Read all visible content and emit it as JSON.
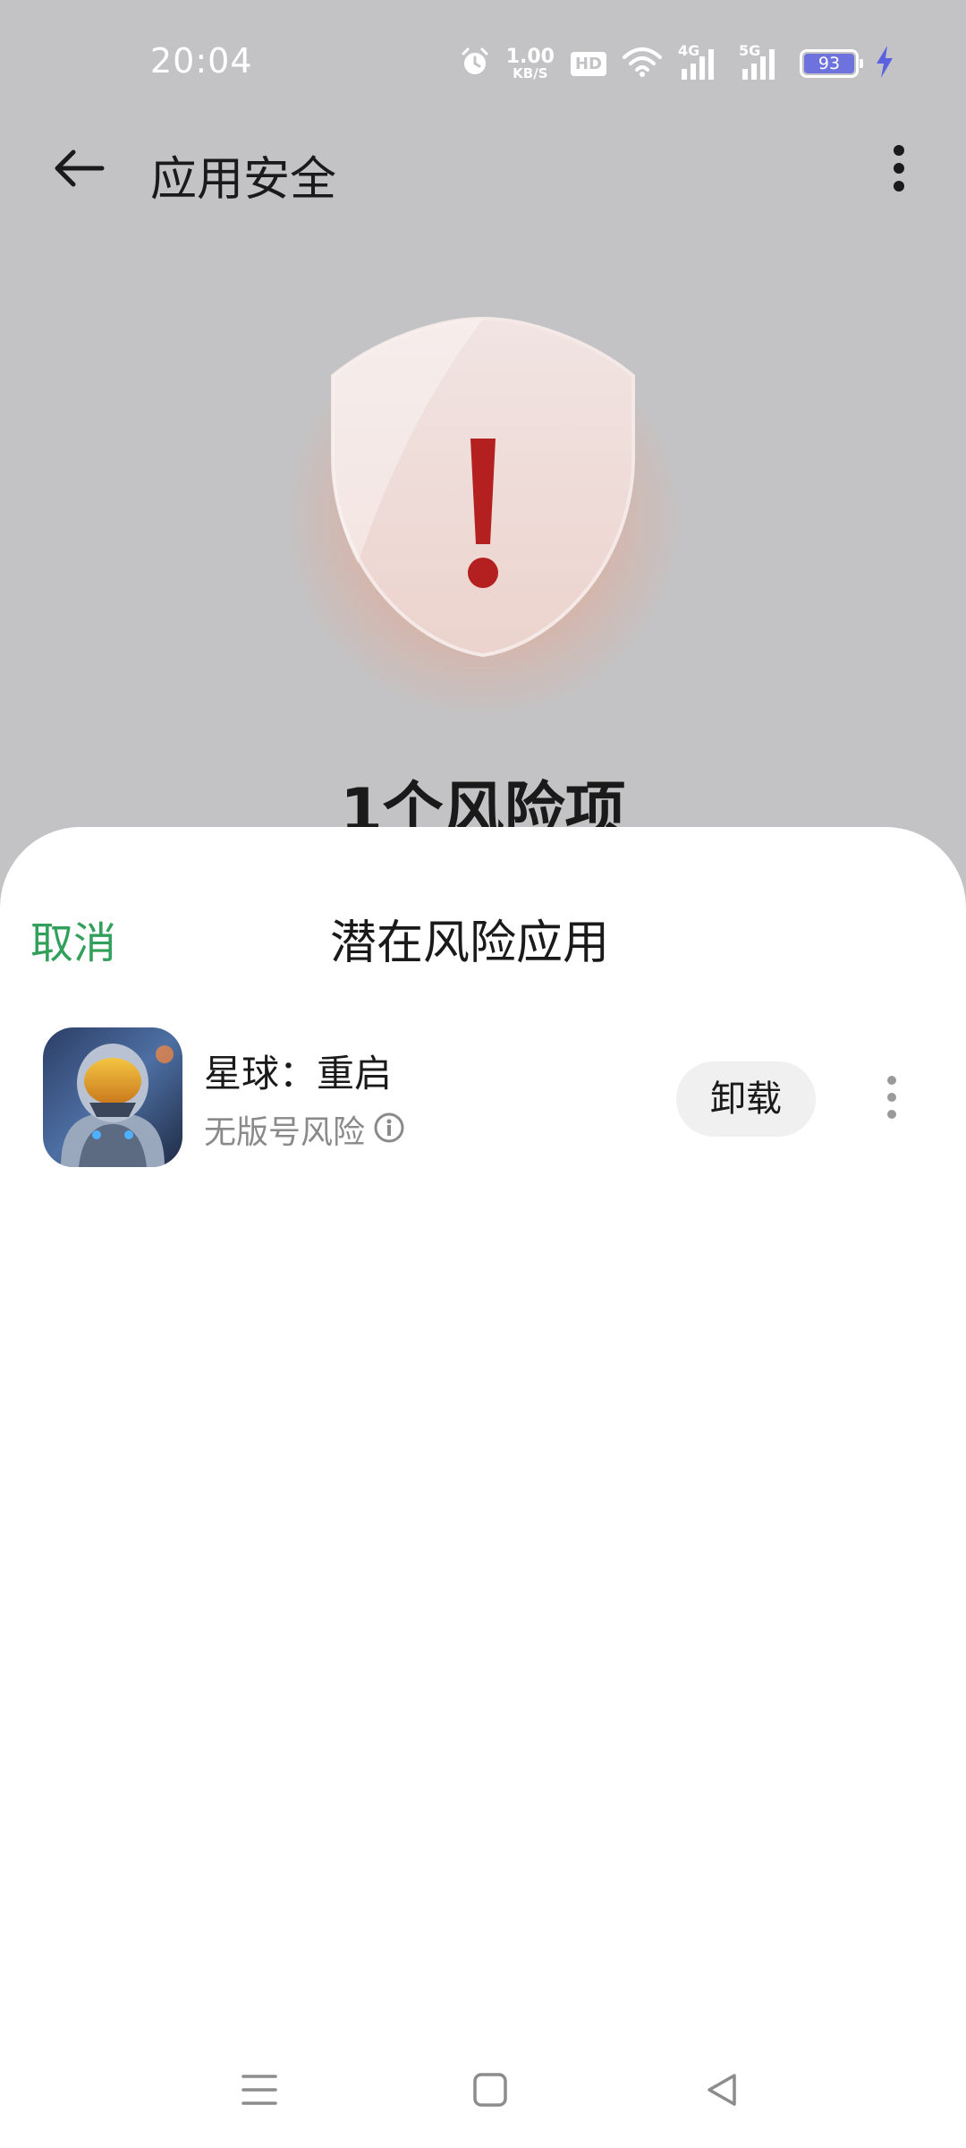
{
  "status_bar": {
    "time": "20:04",
    "net_speed_value": "1.00",
    "net_speed_unit": "KB/S",
    "hd_label": "HD",
    "signal1_label": "4G",
    "signal2_label": "5G",
    "battery_level": "93",
    "icons": [
      "alarm-icon",
      "wifi-icon",
      "signal-icon",
      "battery-icon",
      "charging-icon"
    ],
    "battery_color": "#6e72dd"
  },
  "header": {
    "title": "应用安全"
  },
  "hero": {
    "risk_count_text": "1个风险项"
  },
  "sheet": {
    "cancel_label": "取消",
    "title": "潜在风险应用",
    "accent_color": "#32a05a",
    "apps": [
      {
        "name": "星球：重启",
        "risk_text": "无版号风险",
        "uninstall_label": "卸载"
      }
    ]
  },
  "nav_bar": {
    "icons": [
      "menu-icon",
      "home-icon",
      "back-triangle-icon"
    ]
  }
}
